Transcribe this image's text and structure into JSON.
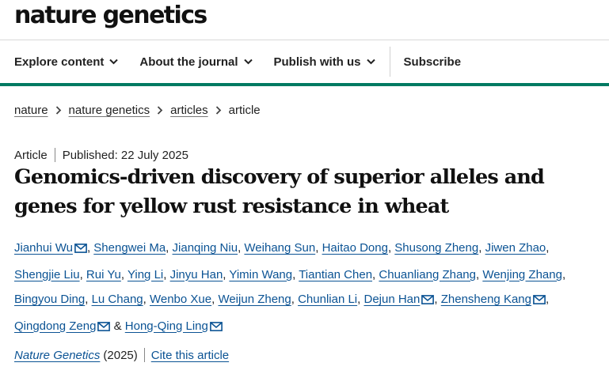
{
  "site": {
    "logo": "nature genetics"
  },
  "nav": {
    "explore": "Explore content",
    "about": "About the journal",
    "publish": "Publish with us",
    "subscribe": "Subscribe"
  },
  "breadcrumb": [
    "nature",
    "nature genetics",
    "articles",
    "article"
  ],
  "article": {
    "type": "Article",
    "published": "Published: 22 July 2025",
    "title": "Genomics-driven discovery of superior alleles and genes for yellow rust resistance in wheat",
    "authors_line1": [
      "Jianhui Wu",
      "Shengwei Ma",
      "Jianqing Niu",
      "Weihang Sun",
      "Haitao Dong",
      "Shusong Zheng",
      "Jiwen Zhao"
    ],
    "authors_line2": [
      "Shengjie Liu",
      "Rui Yu",
      "Ying Li",
      "Jinyu Han",
      "Yimin Wang",
      "Tiantian Chen",
      "Chuanliang Zhang",
      "Wenjing Zhang"
    ],
    "authors_line3": [
      "Bingyou Ding",
      "Lu Chang",
      "Wenbo Xue",
      "Weijun Zheng",
      "Chunlian Li",
      "Dejun Han",
      "Zhensheng Kang"
    ],
    "authors_line4": [
      "Qingdong Zeng",
      "Hong-Qing Ling"
    ],
    "and_sign": "&",
    "journal": "Nature Genetics",
    "year": "(2025)",
    "cite": "Cite this article"
  },
  "colors": {
    "accent": "#007a62",
    "link": "#0b5394"
  },
  "icons": [
    "chevron-down-icon",
    "chevron-right-icon",
    "mail-icon"
  ]
}
